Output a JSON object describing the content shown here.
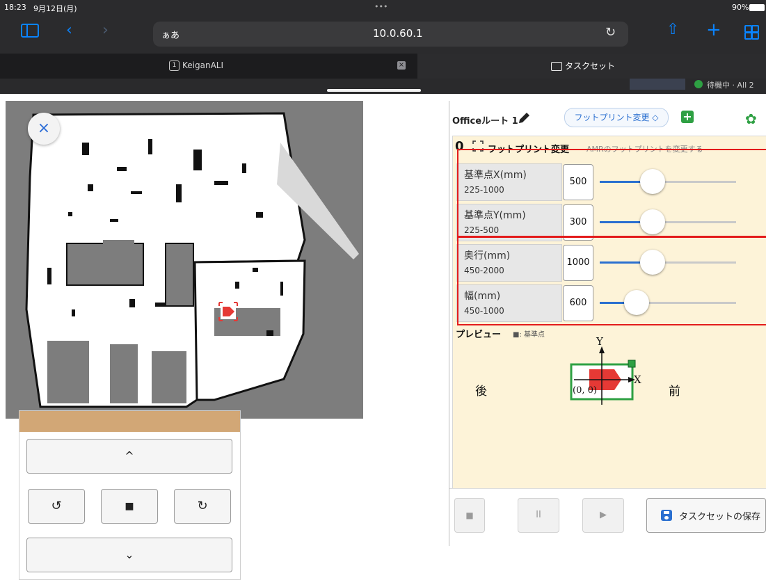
{
  "status": {
    "time": "18:23",
    "date": "9月12日(月)",
    "dots": "•••",
    "battery": "90%"
  },
  "browser": {
    "address_left": "ぁあ",
    "url": "10.0.60.1",
    "tabs": [
      {
        "label": "KeiganALI",
        "num": "1"
      },
      {
        "label": "タスクセット"
      }
    ],
    "strip_text": "待機中 · All 2"
  },
  "map": {
    "close_label": "×"
  },
  "joystick": {
    "up": "^",
    "down": "⌄",
    "rot_left": "↺",
    "stop": "■",
    "rot_right": "↻"
  },
  "panel": {
    "route_title": "Officeルート 1",
    "footprint_select": "フットプリント変更 ◇",
    "task_index": "0",
    "task_title": "フットプリント変更",
    "task_desc": "AMRのフットプリントを変更する",
    "params": [
      {
        "name": "基準点X(mm)",
        "range": "225-1000",
        "value": "500",
        "level": 0.39
      },
      {
        "name": "基準点Y(mm)",
        "range": "225-500",
        "value": "300",
        "level": 0.39
      },
      {
        "name": "奥行(mm)",
        "range": "450-2000",
        "value": "1000",
        "level": 0.39
      },
      {
        "name": "幅(mm)",
        "range": "450-1000",
        "value": "600",
        "level": 0.27
      }
    ],
    "preview": {
      "label": "プレビュー",
      "legend": "■: 基準点",
      "back": "後",
      "front": "前",
      "axis_y": "Y",
      "axis_x": "X",
      "origin": "(0, 0)"
    },
    "controls": {
      "stop": "■",
      "pause": "II",
      "play": "▶",
      "save": "タスクセットの保存"
    },
    "colors": {
      "accent": "#2a6fd0",
      "green": "#2ea043",
      "red": "#e53935",
      "highlight": "#e31b1b"
    }
  }
}
